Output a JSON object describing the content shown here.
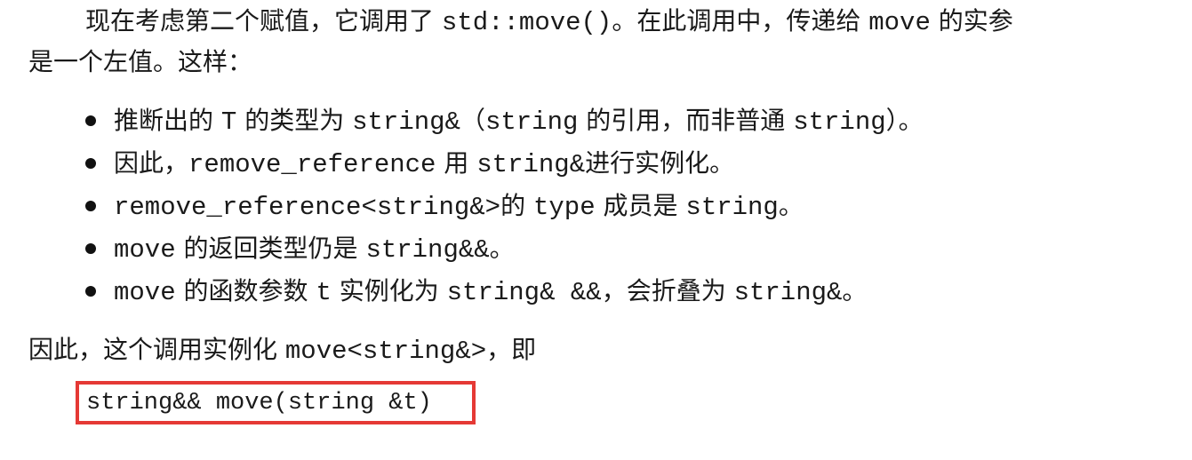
{
  "paragraph1": {
    "line1": {
      "t1": "现在考虑第二个赋值，它调用了 ",
      "c1": "std::move()",
      "t2": "。在此调用中，传递给 ",
      "c2": "move",
      "t3": " 的实参"
    },
    "line2": "是一个左值。这样："
  },
  "bullets": [
    {
      "t1": "推断出的 ",
      "c1": "T",
      "t2": " 的类型为 ",
      "c2": "string&",
      "t3": "（",
      "c3": "string",
      "t4": " 的引用，而非普通 ",
      "c4": "string",
      "t5": "）。"
    },
    {
      "t1": "因此，",
      "c1": "remove_reference",
      "t2": " 用 ",
      "c2": "string&",
      "t3": "进行实例化。"
    },
    {
      "c1": "remove_reference<string&>",
      "t1": "的 ",
      "c2": "type",
      "t2": " 成员是 ",
      "c3": "string",
      "t3": "。"
    },
    {
      "c1": "move",
      "t1": " 的返回类型仍是 ",
      "c2": "string&&",
      "t2": "。"
    },
    {
      "c1": "move",
      "t1": " 的函数参数 ",
      "c2": "t",
      "t2": " 实例化为 ",
      "c3": "string& &&",
      "t3": "，会折叠为 ",
      "c4": "string&",
      "t4": "。"
    }
  ],
  "conclusion": {
    "t1": "因此，这个调用实例化 ",
    "c1": "move<string&>",
    "t2": "，即"
  },
  "code_block": "string&& move(string &t)",
  "colors": {
    "highlight_border": "#e53935"
  }
}
